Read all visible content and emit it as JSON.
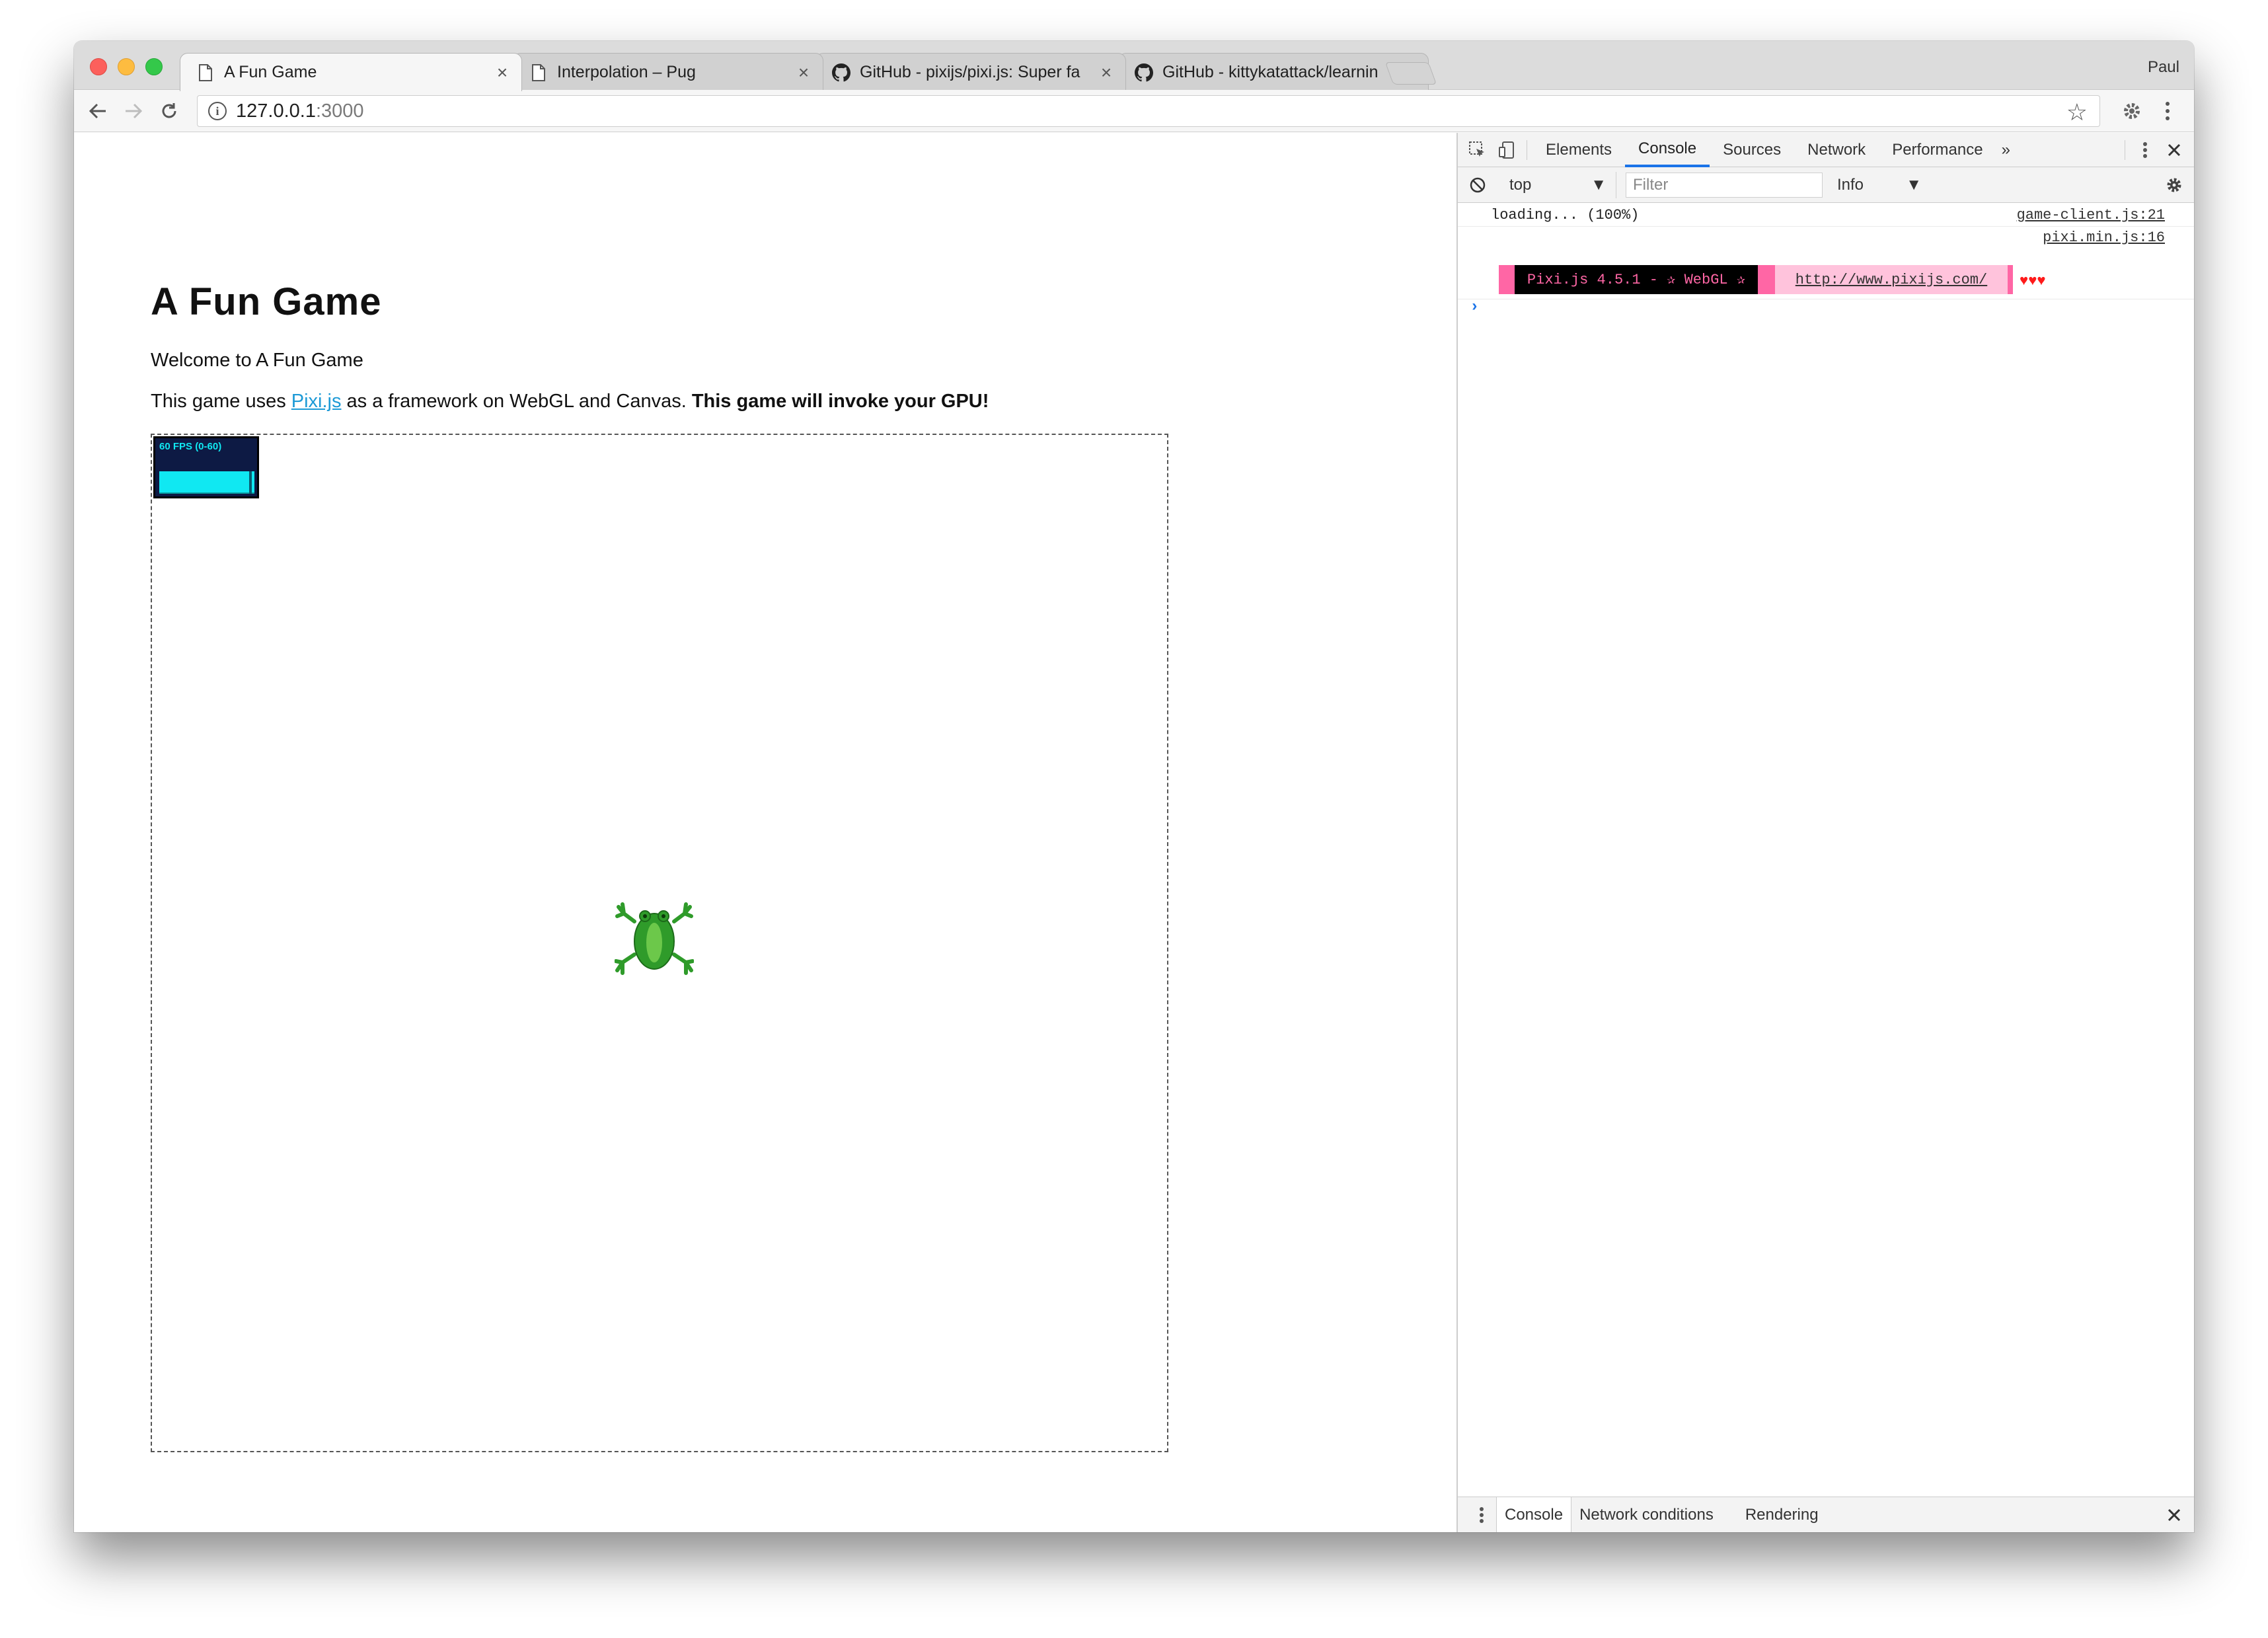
{
  "browser": {
    "profile": "Paul",
    "tabs": [
      {
        "title": "A Fun Game",
        "icon": "page-icon",
        "active": true
      },
      {
        "title": "Interpolation – Pug",
        "icon": "page-icon",
        "active": false
      },
      {
        "title": "GitHub - pixijs/pixi.js: Super fa",
        "icon": "github-icon",
        "active": false
      },
      {
        "title": "GitHub - kittykatattack/learnin",
        "icon": "github-icon",
        "active": false
      }
    ],
    "close_glyph": "×",
    "address": {
      "host": "127.0.0.1",
      "port": ":3000"
    }
  },
  "page": {
    "heading": "A Fun Game",
    "welcome": "Welcome to A Fun Game",
    "uses_prefix": "This game uses ",
    "uses_link": "Pixi.js",
    "uses_middle": " as a framework on WebGL and Canvas. ",
    "uses_bold": "This game will invoke your GPU!",
    "fps_label": "60 FPS (0-60)",
    "sprite": "frog-sprite"
  },
  "devtools": {
    "tabs": [
      "Elements",
      "Console",
      "Sources",
      "Network",
      "Performance"
    ],
    "active_tab": "Console",
    "more": "»",
    "context": "top",
    "filter_placeholder": "Filter",
    "level": "Info",
    "console": {
      "line1_text": "loading... (100%)",
      "line1_src": "game-client.js:21",
      "line2_src": "pixi.min.js:16",
      "banner_main": "Pixi.js 4.5.1 - ✰ WebGL ✰",
      "banner_url": "http://www.pixijs.com/",
      "hearts": "♥♥♥",
      "prompt": "›"
    },
    "drawer": {
      "tabs": [
        "Console",
        "Network conditions",
        "Rendering"
      ],
      "active": "Console"
    }
  },
  "colors": {
    "accent": "#1a73e8",
    "link": "#1d9ad6",
    "pixi_pink": "#ff66a5",
    "fps_cyan": "#10e8f2"
  }
}
